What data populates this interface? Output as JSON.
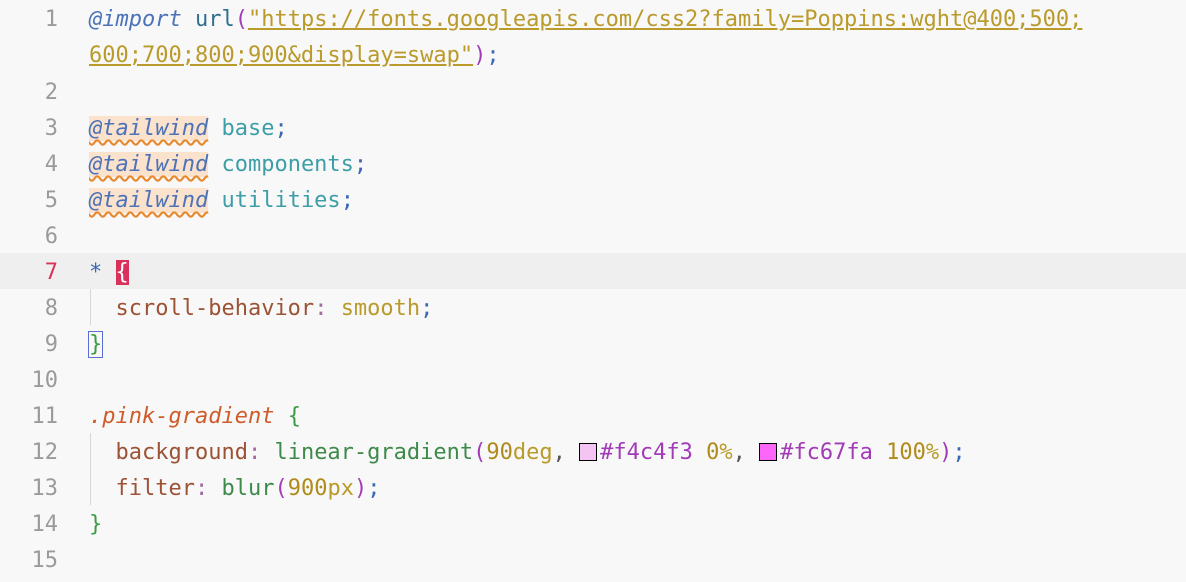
{
  "editor": {
    "current_line": 7,
    "lines": [
      {
        "number": "1"
      },
      {
        "number": "2"
      },
      {
        "number": "3"
      },
      {
        "number": "4"
      },
      {
        "number": "5"
      },
      {
        "number": "6"
      },
      {
        "number": "7"
      },
      {
        "number": "8"
      },
      {
        "number": "9"
      },
      {
        "number": "10"
      },
      {
        "number": "11"
      },
      {
        "number": "12"
      },
      {
        "number": "13"
      },
      {
        "number": "14"
      },
      {
        "number": "15"
      }
    ],
    "tokens": {
      "import_kw": "@import",
      "url_fn": "url",
      "url_str_1": "\"https://fonts.googleapis.com/css2?family=Poppins:wght@400;500;",
      "url_str_2": "600;700;800;900&display=swap\"",
      "tailwind_kw": "@tailwind",
      "tw_base": "base",
      "tw_components": "components",
      "tw_utilities": "utilities",
      "star": "*",
      "open_brace": "{",
      "close_brace": "}",
      "scroll_prop": "scroll-behavior",
      "scroll_val": "smooth",
      "selector": ".pink-gradient",
      "bg_prop": "background",
      "gradient_fn": "linear-gradient",
      "deg_num": "90",
      "deg_unit": "deg",
      "hex1": "#f4c4f3",
      "stop1_num": "0",
      "hex2": "#fc67fa",
      "stop2_num": "100",
      "percent": "%",
      "filter_prop": "filter",
      "blur_fn": "blur",
      "blur_num": "900",
      "blur_unit": "px"
    },
    "swatch_colors": {
      "hex1": "#f4c4f3",
      "hex2": "#fc67fa"
    }
  }
}
